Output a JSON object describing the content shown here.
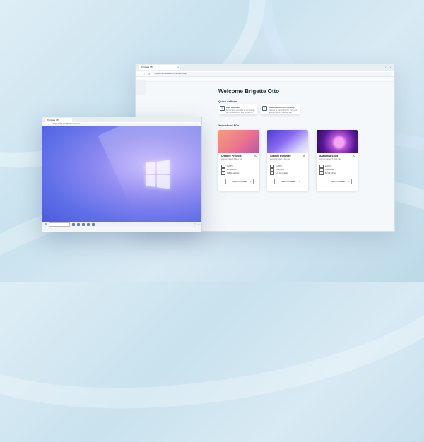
{
  "back_window": {
    "tab_title": "Windows 365",
    "url": "https://windows365.microsoft.com",
    "welcome": "Welcome Brigette Otto",
    "quick_actions_title": "Quick actions",
    "quick_actions": [
      {
        "title": "Give Feedback",
        "desc": "Tell us what you'd like to see change with Windows 365 and Cloud PCs",
        "icon": "feedback-icon"
      },
      {
        "title": "Download Remote Desktop",
        "desc": "Connect to your Cloud PC from your desktop Remote Desktop app",
        "icon": "download-icon"
      }
    ],
    "cloud_pcs_title": "Your cloud PCs",
    "cloud_pcs": [
      {
        "name": "Creative Projects",
        "sub": "Last connected 3 days ago",
        "cpu": "4 vCPU",
        "ram": "16 GB RAM",
        "storage": "128 GB storage",
        "button": "Open in browser"
      },
      {
        "name": "Adatum Everyday",
        "sub": "Last connected 1 day ago",
        "cpu": "2 vCPU",
        "ram": "8 GB RAM",
        "storage": "128 GB storage",
        "button": "Open in browser"
      },
      {
        "name": "Adatum Archive",
        "sub": "Last connected 5 days ago",
        "cpu": "2 vCPU",
        "ram": "4 GB RAM",
        "storage": "64 GB storage",
        "button": "Open in browser"
      }
    ]
  },
  "front_window": {
    "tab_title": "Windows 365",
    "url": "https://windows365.microsoft.com",
    "taskbar": {
      "search_placeholder": "Type here to search",
      "time": "10:00 AM"
    }
  }
}
